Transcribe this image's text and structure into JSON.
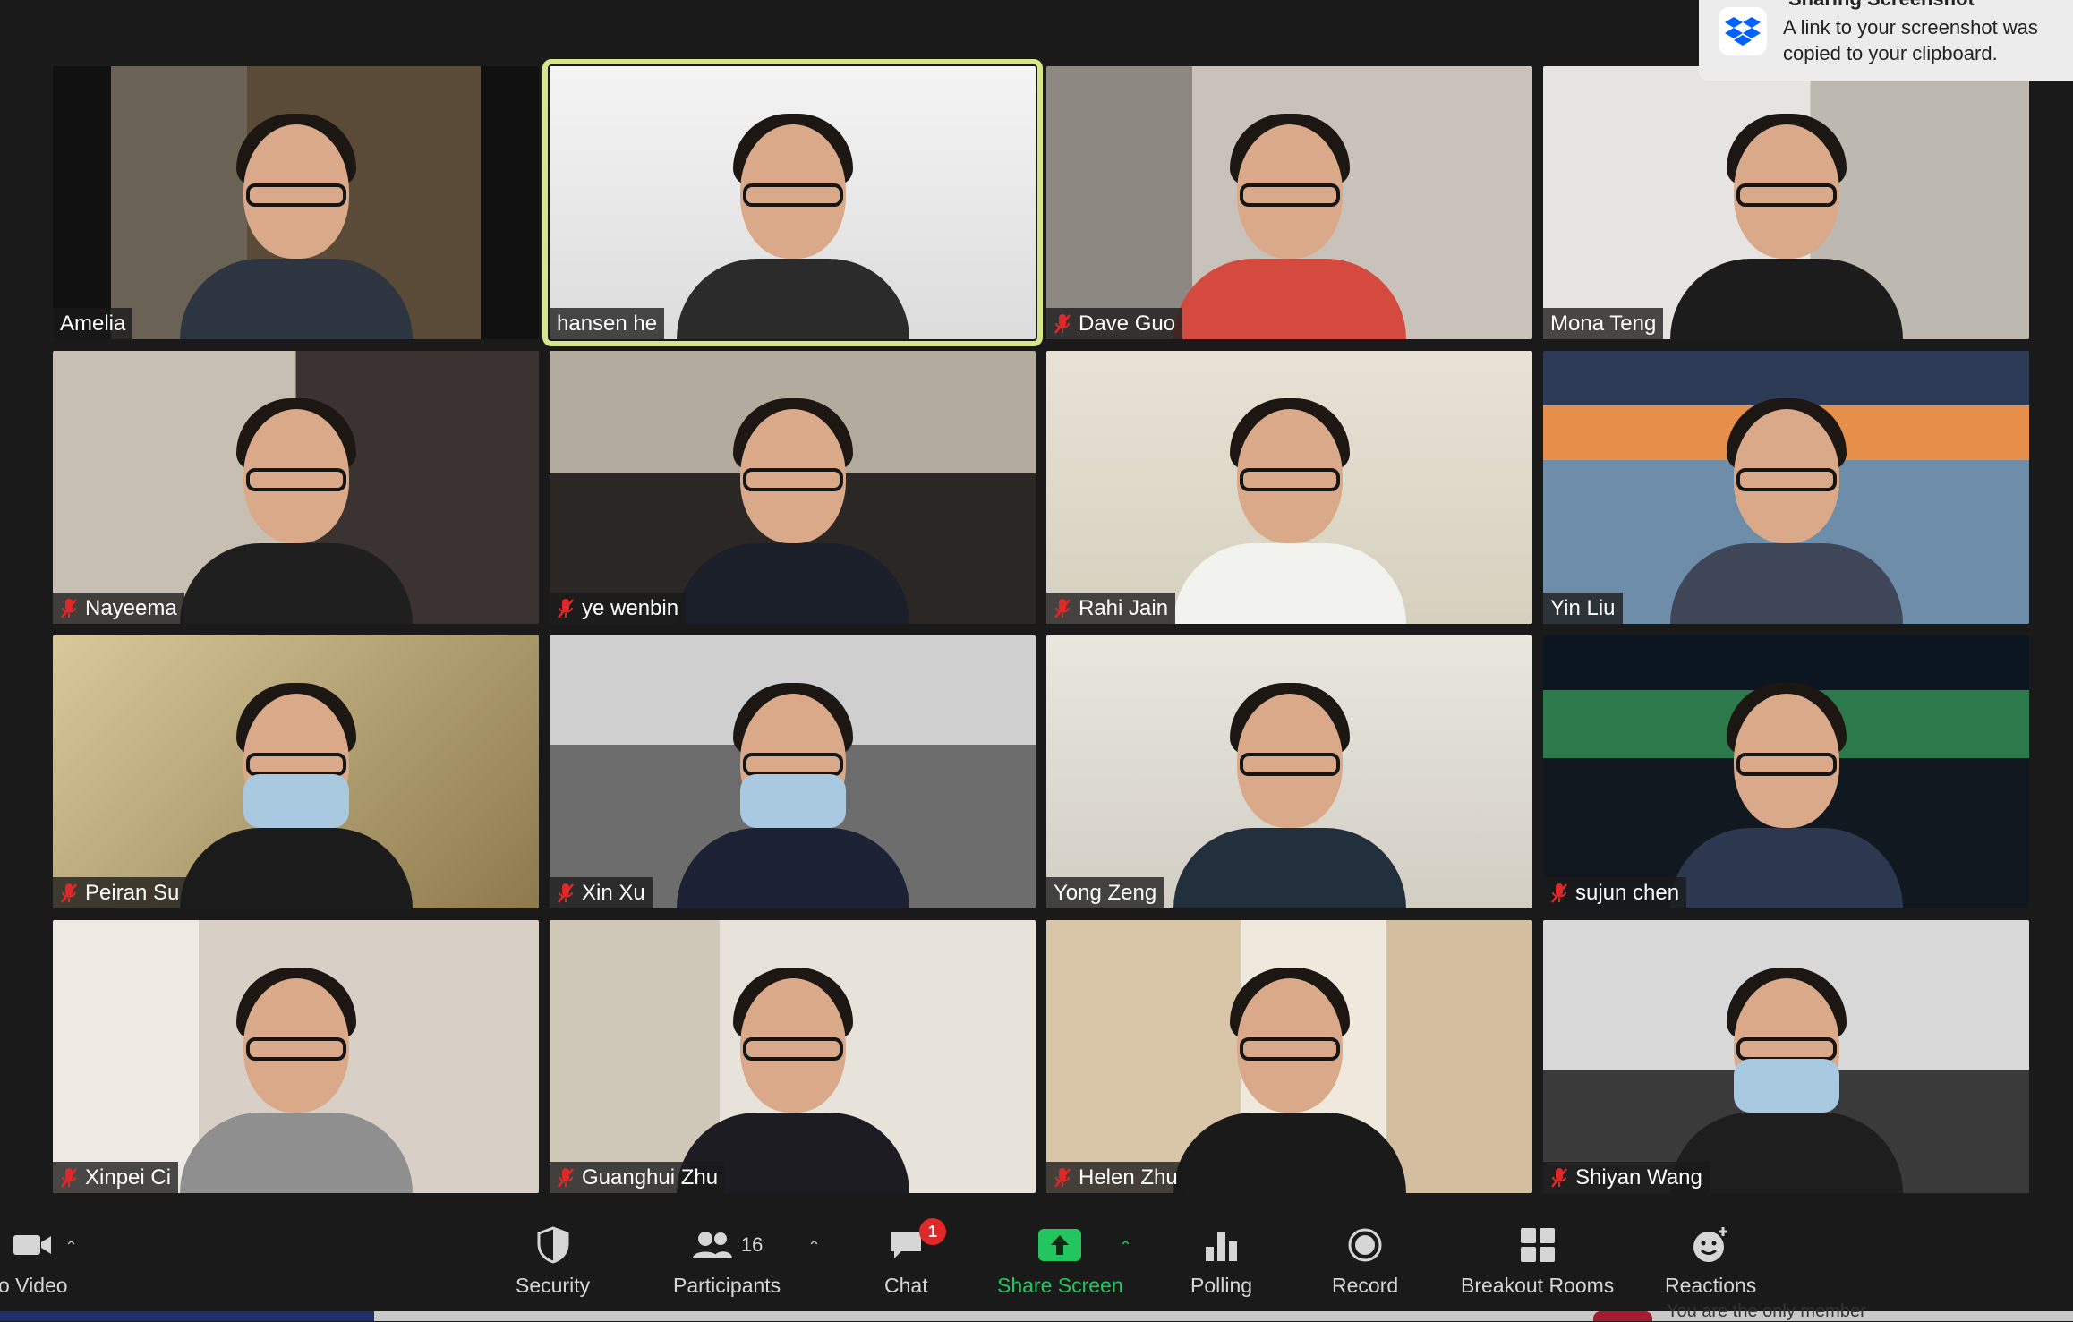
{
  "notification": {
    "title": "Sharing Screenshot",
    "message_line1": "A link to your screenshot was",
    "message_line2": "copied to your clipboard.",
    "icon": "dropbox-icon"
  },
  "participants": [
    {
      "name": "Amelia",
      "muted": false,
      "active": false
    },
    {
      "name": "hansen he",
      "muted": false,
      "active": true
    },
    {
      "name": "Dave Guo",
      "muted": true,
      "active": false
    },
    {
      "name": "Mona Teng",
      "muted": false,
      "active": false
    },
    {
      "name": "Nayeema",
      "muted": true,
      "active": false
    },
    {
      "name": "ye wenbin",
      "muted": true,
      "active": false
    },
    {
      "name": "Rahi Jain",
      "muted": true,
      "active": false
    },
    {
      "name": "Yin Liu",
      "muted": false,
      "active": false
    },
    {
      "name": "Peiran Su",
      "muted": true,
      "active": false
    },
    {
      "name": "Xin Xu",
      "muted": true,
      "active": false
    },
    {
      "name": "Yong Zeng",
      "muted": false,
      "active": false
    },
    {
      "name": "sujun chen",
      "muted": true,
      "active": false
    },
    {
      "name": "Xinpei Ci",
      "muted": true,
      "active": false
    },
    {
      "name": "Guanghui Zhu",
      "muted": true,
      "active": false
    },
    {
      "name": "Helen Zhu",
      "muted": true,
      "active": false
    },
    {
      "name": "Shiyan Wang",
      "muted": true,
      "active": false
    }
  ],
  "toolbar": {
    "video_label": "o Video",
    "security_label": "Security",
    "participants_label": "Participants",
    "participants_count": "16",
    "chat_label": "Chat",
    "chat_badge": "1",
    "share_label": "Share Screen",
    "polling_label": "Polling",
    "record_label": "Record",
    "breakout_label": "Breakout Rooms",
    "reactions_label": "Reactions"
  },
  "bottom_text": "You are the only member",
  "colors": {
    "background": "#1a1a1a",
    "active_speaker_border": "#d7e68a",
    "share_green": "#22c55e",
    "muted_red": "#e02828"
  }
}
